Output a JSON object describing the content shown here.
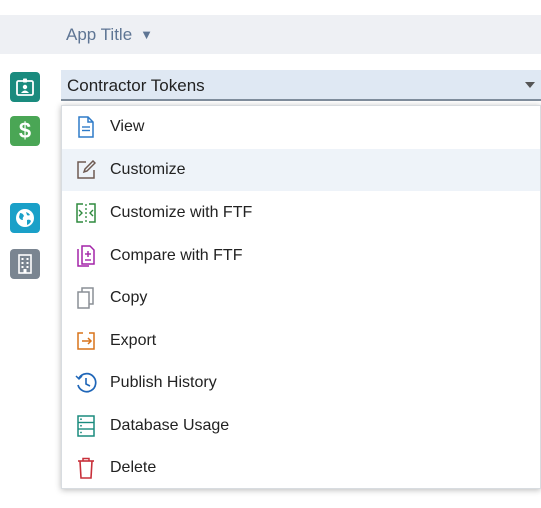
{
  "header": {
    "app_title": "App Title",
    "caret": "▼"
  },
  "select": {
    "value": "Contractor Tokens"
  },
  "sidebar": {
    "icons": [
      {
        "name": "badge-icon",
        "color": "#1a8b7e"
      },
      {
        "name": "dollar-icon",
        "color": "#4aa655"
      },
      {
        "name": "globe-icon",
        "color": "#1aa0c8"
      },
      {
        "name": "building-icon",
        "color": "#7a8591"
      }
    ]
  },
  "menu": {
    "highlighted": "Customize",
    "items": [
      {
        "label": "View",
        "icon": "document-icon",
        "color": "#2f7bc8"
      },
      {
        "label": "Customize",
        "icon": "edit-icon",
        "color": "#6e5a52"
      },
      {
        "label": "Customize with FTF",
        "icon": "ftf-customize-icon",
        "color": "#2e8a3e"
      },
      {
        "label": "Compare with FTF",
        "icon": "compare-icon",
        "color": "#a324a8"
      },
      {
        "label": "Copy",
        "icon": "copy-icon",
        "color": "#8a8f96"
      },
      {
        "label": "Export",
        "icon": "export-icon",
        "color": "#d9731a"
      },
      {
        "label": "Publish History",
        "icon": "history-icon",
        "color": "#1f66b8"
      },
      {
        "label": "Database Usage",
        "icon": "database-icon",
        "color": "#1a8b7e"
      },
      {
        "label": "Delete",
        "icon": "trash-icon",
        "color": "#c8303a"
      }
    ]
  }
}
